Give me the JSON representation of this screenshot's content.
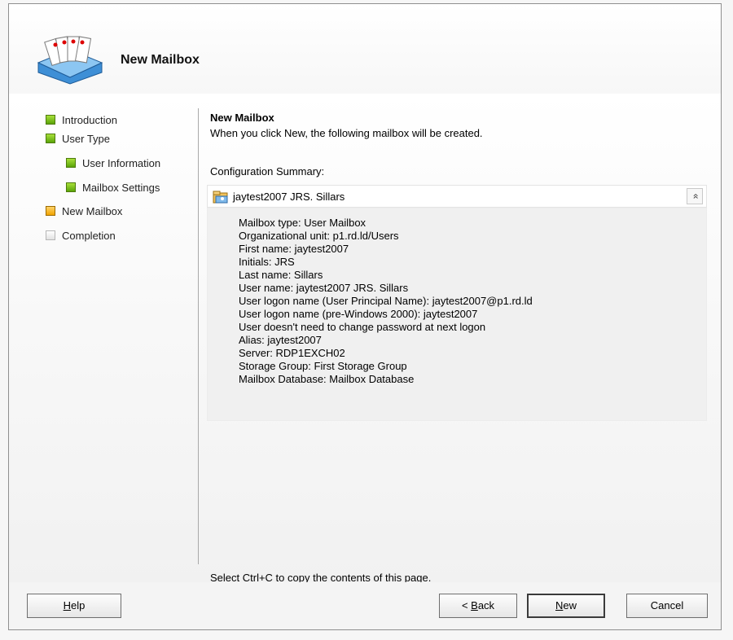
{
  "window": {
    "title": "New Mailbox"
  },
  "steps": [
    {
      "label": "Introduction",
      "state": "done"
    },
    {
      "label": "User Type",
      "state": "done"
    },
    {
      "label": "User Information",
      "state": "done"
    },
    {
      "label": "Mailbox Settings",
      "state": "done"
    },
    {
      "label": "New Mailbox",
      "state": "current"
    },
    {
      "label": "Completion",
      "state": "pending"
    }
  ],
  "main": {
    "title": "New Mailbox",
    "description": "When you click New, the following mailbox will be created.",
    "config_label": "Configuration Summary:",
    "summary_title": "jaytest2007 JRS. Sillars",
    "summary_lines": [
      "Mailbox type: User Mailbox",
      "Organizational unit: p1.rd.ld/Users",
      "First name: jaytest2007",
      "Initials: JRS",
      "Last name: Sillars",
      "User name: jaytest2007 JRS. Sillars",
      "User logon name (User Principal Name): jaytest2007@p1.rd.ld",
      "User logon name (pre-Windows 2000): jaytest2007",
      "User doesn't need to change password at next logon",
      "Alias: jaytest2007",
      "Server: RDP1EXCH02",
      "Storage Group: First Storage Group",
      "Mailbox Database: Mailbox Database"
    ],
    "collapse_glyph": "»",
    "footer_note": "Select Ctrl+C to copy the contents of this page."
  },
  "buttons": {
    "help": {
      "mnemonic": "H",
      "rest": "elp"
    },
    "back": {
      "prefix": "< ",
      "mnemonic": "B",
      "rest": "ack"
    },
    "new": {
      "mnemonic": "N",
      "rest": "ew"
    },
    "cancel": "Cancel"
  },
  "colors": {
    "step_done": "#5aa409",
    "step_current": "#f1a400",
    "step_pending": "#e2e2e2"
  }
}
